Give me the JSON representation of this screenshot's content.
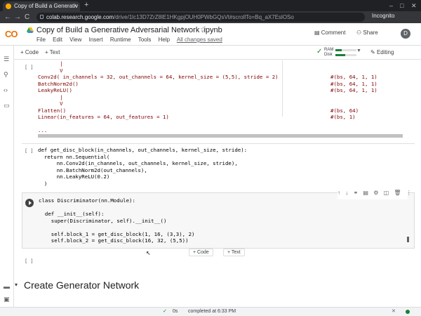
{
  "browser": {
    "tab_title": "Copy of Build a Generativ",
    "tab_close": "×",
    "new_tab": "+",
    "url_host": "colab.research.google.com",
    "url_path": "/drive/1lc13D7ZrZ8lE1HKgpjOUH0PWbGQsVt#scrollTo=Bq_aX7EslOSo",
    "incognito_label": "Incognito",
    "win_min": "–",
    "win_max": "□",
    "win_close": "✕",
    "back": "←",
    "forward": "→",
    "reload": "C"
  },
  "header": {
    "logo": "CO",
    "title": "Copy of Build a Generative Adversarial Network .ipynb",
    "star": "☆",
    "menu": [
      "File",
      "Edit",
      "View",
      "Insert",
      "Runtime",
      "Tools",
      "Help"
    ],
    "save_status": "All changes saved",
    "comment_label": "Comment",
    "share_label": "Share",
    "avatar_letter": "D"
  },
  "toolbar": {
    "add_code": "+ Code",
    "add_text": "+ Text",
    "ram_label": "RAM",
    "disk_label": "Disk",
    "ram_fraction": 0.3,
    "disk_fraction": 0.45,
    "editing_label": "Editing"
  },
  "cells": {
    "output_bracket": "[ ]",
    "output_lines": [
      "       |",
      "       V",
      "Conv2d( in_channels = 32, out_channels = 64, kernel_size = (5,5), stride = 2)",
      "BatchNorm2d()",
      "LeakyReLU()",
      "       |",
      "       V",
      "Flatten()",
      "Linear(in_features = 64, out_features = 1)",
      "",
      "..."
    ],
    "output_shapes": [
      "",
      "",
      "#(bs, 64, 1, 1)",
      "#(bs, 64, 1, 1)",
      "#(bs, 64, 1, 1)",
      "",
      "",
      "#(bs, 64)",
      "#(bs, 1)",
      "",
      ""
    ],
    "cell2_bracket": "[ ]",
    "cell2_lines": [
      "def get_disc_block(in_channels, out_channels, kernel_size, stride):",
      "  return nn.Sequential(",
      "      nn.Conv2d(in_channels, out_channels, kernel_size, stride),",
      "      nn.BatchNorm2d(out_channels),",
      "      nn.LeakyReLU(0.2)",
      "  )"
    ],
    "cell3_lines": [
      "class Discriminator(nn.Module):",
      "",
      "  def __init__(self):",
      "    super(Discriminator, self).__init__()",
      "",
      "    self.block_1 = get_disc_block(1, 16, (3,3), 2)",
      "    self.block_2 = get_disc_block(16, 32, (5,5))"
    ],
    "cell4_bracket": "[ ]",
    "add_code": "+ Code",
    "add_text": "+ Text",
    "section_title": "Create Generator Network"
  },
  "status": {
    "check": "✓",
    "elapsed": "0s",
    "completed": "completed at 6:33 PM",
    "close": "✕"
  }
}
